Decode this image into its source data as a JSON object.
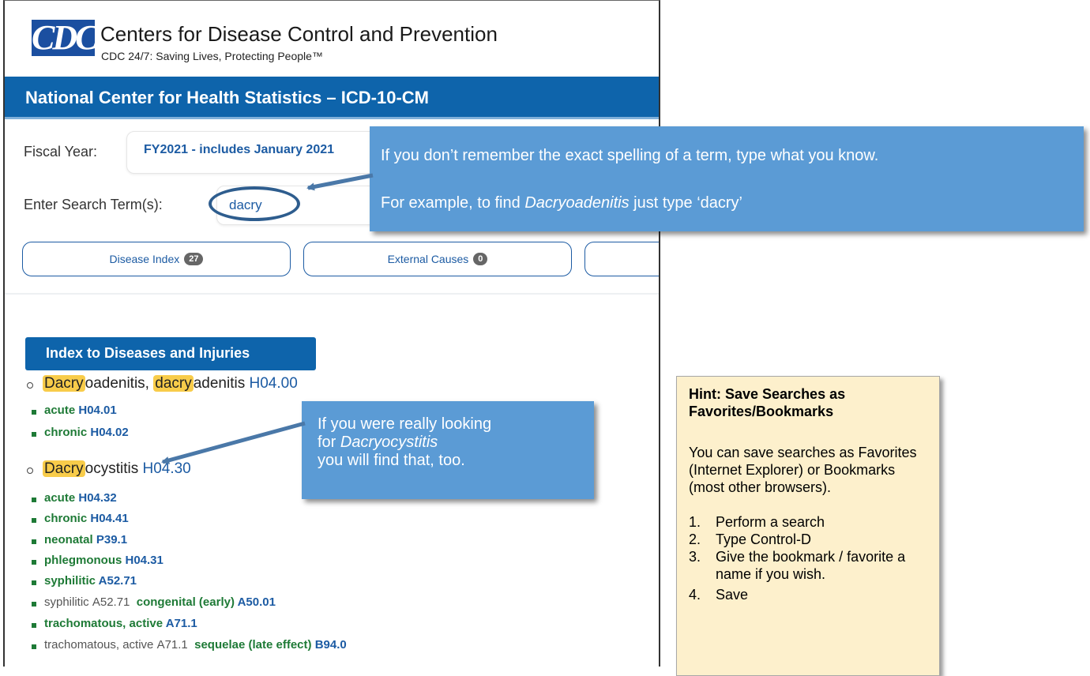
{
  "header": {
    "logo_text": "CDC",
    "org_title": "Centers for Disease Control and Prevention",
    "tagline": "CDC 24/7: Saving Lives, Protecting People™"
  },
  "banner": {
    "title": "National Center for Health Statistics – ICD-10-CM"
  },
  "search": {
    "fiscal_year_label": "Fiscal Year:",
    "fiscal_year_value": "FY2021 - includes January 2021",
    "term_label": "Enter Search Term(s):",
    "term_value": "dacry"
  },
  "tabs": [
    {
      "label": "Disease Index",
      "count": "27"
    },
    {
      "label": "External Causes",
      "count": "0"
    }
  ],
  "results": {
    "header": "Index to Diseases and Injuries",
    "entries": [
      {
        "hl1": "Dacry",
        "rest1": "oadenitis, ",
        "hl2": "dacry",
        "rest2": "adenitis",
        "code": "H04.00",
        "subs": [
          {
            "term": "acute",
            "code": "H04.01"
          },
          {
            "term": "chronic",
            "code": "H04.02"
          }
        ]
      },
      {
        "hl1": "Dacry",
        "rest1": "ocystitis",
        "code": "H04.30",
        "subs": [
          {
            "term": "acute",
            "code": "H04.32"
          },
          {
            "term": "chronic",
            "code": "H04.41"
          },
          {
            "term": "neonatal",
            "code": "P39.1"
          },
          {
            "term": "phlegmonous",
            "code": "H04.31"
          },
          {
            "term": "syphilitic",
            "code": "A52.71"
          },
          {
            "parent": "syphilitic",
            "parent_code": "A52.71",
            "term": "congenital (early)",
            "code": "A50.01"
          },
          {
            "term": "trachomatous, active",
            "code": "A71.1"
          },
          {
            "parent": "trachomatous, active",
            "parent_code": "A71.1",
            "term": "sequelae (late effect)",
            "code": "B94.0"
          }
        ]
      }
    ]
  },
  "callouts": {
    "top_line1": "If you don’t remember the exact spelling of a term, type what you know.",
    "top_line2_prefix": "For example, to find ",
    "top_line2_term": "Dacryoadenitis",
    "top_line2_suffix": " just type ‘dacry’",
    "mid_line1": "If you were really looking",
    "mid_line2_prefix": "for ",
    "mid_line2_term": "Dacryocystitis",
    "mid_line3": "you will find that, too."
  },
  "hint": {
    "title": "Hint: Save Searches as Favorites/Bookmarks",
    "body": "You can save searches as Favorites (Internet Explorer) or Bookmarks (most other browsers).",
    "steps": [
      "Perform a search",
      "Type Control-D",
      "Give the bookmark / favorite a name if you wish.",
      "Save"
    ]
  },
  "colors": {
    "banner_blue": "#0e64ab",
    "callout_blue": "#5b9bd5",
    "highlight_yellow": "#f8cc4a",
    "hint_background": "#fdf0cc",
    "link_blue": "#1c5ba3",
    "term_green": "#1e7a36"
  },
  "icons": {
    "logo": "cdc-logo"
  }
}
